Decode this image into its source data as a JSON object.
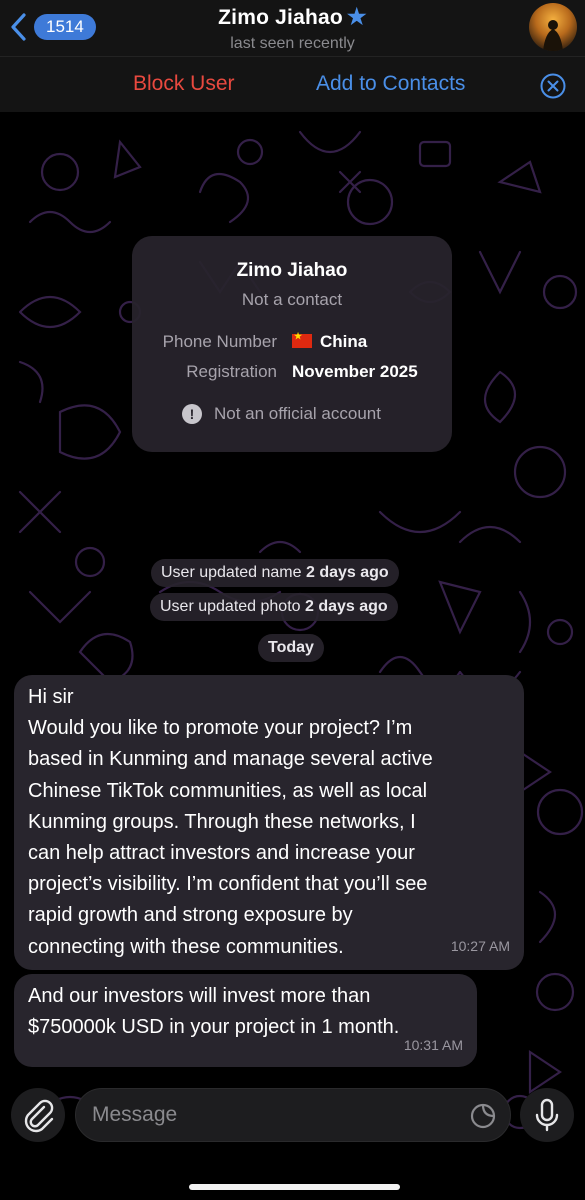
{
  "header": {
    "back_count": "1514",
    "title": "Zimo Jiahao",
    "subtitle": "last seen recently"
  },
  "actions": {
    "block": "Block User",
    "add": "Add to Contacts"
  },
  "info_card": {
    "name": "Zimo Jiahao",
    "status": "Not a contact",
    "rows": [
      {
        "label": "Phone Number",
        "value": "China"
      },
      {
        "label": "Registration",
        "value": "November 2025"
      }
    ],
    "notice": "Not an official account"
  },
  "service": {
    "name_prefix": "User updated name",
    "name_time": "2 days ago",
    "photo_prefix": "User updated photo",
    "photo_time": "2 days ago",
    "date": "Today"
  },
  "messages": [
    {
      "lines": [
        "Hi sir",
        "Would you like to promote your project? I’m",
        "based in Kunming and manage several active",
        "Chinese TikTok communities, as well as local",
        "Kunming groups. Through these networks, I",
        "can help attract investors and increase your",
        "project’s visibility. I’m confident that you’ll see",
        "rapid growth and strong exposure by",
        "connecting with these communities."
      ],
      "time": "10:27 AM"
    },
    {
      "lines": [
        "And our investors will invest more than",
        "$750000k USD in your project in 1 month."
      ],
      "time": "10:31 AM"
    }
  ],
  "composer": {
    "placeholder": "Message"
  },
  "colors": {
    "accent": "#4a8fe8",
    "danger": "#e8493f",
    "bubble": "#28252d"
  },
  "icons": [
    "chevron-left-icon",
    "star-icon",
    "close-icon",
    "paperclip-icon",
    "sticker-icon",
    "microphone-icon",
    "alert-icon"
  ]
}
